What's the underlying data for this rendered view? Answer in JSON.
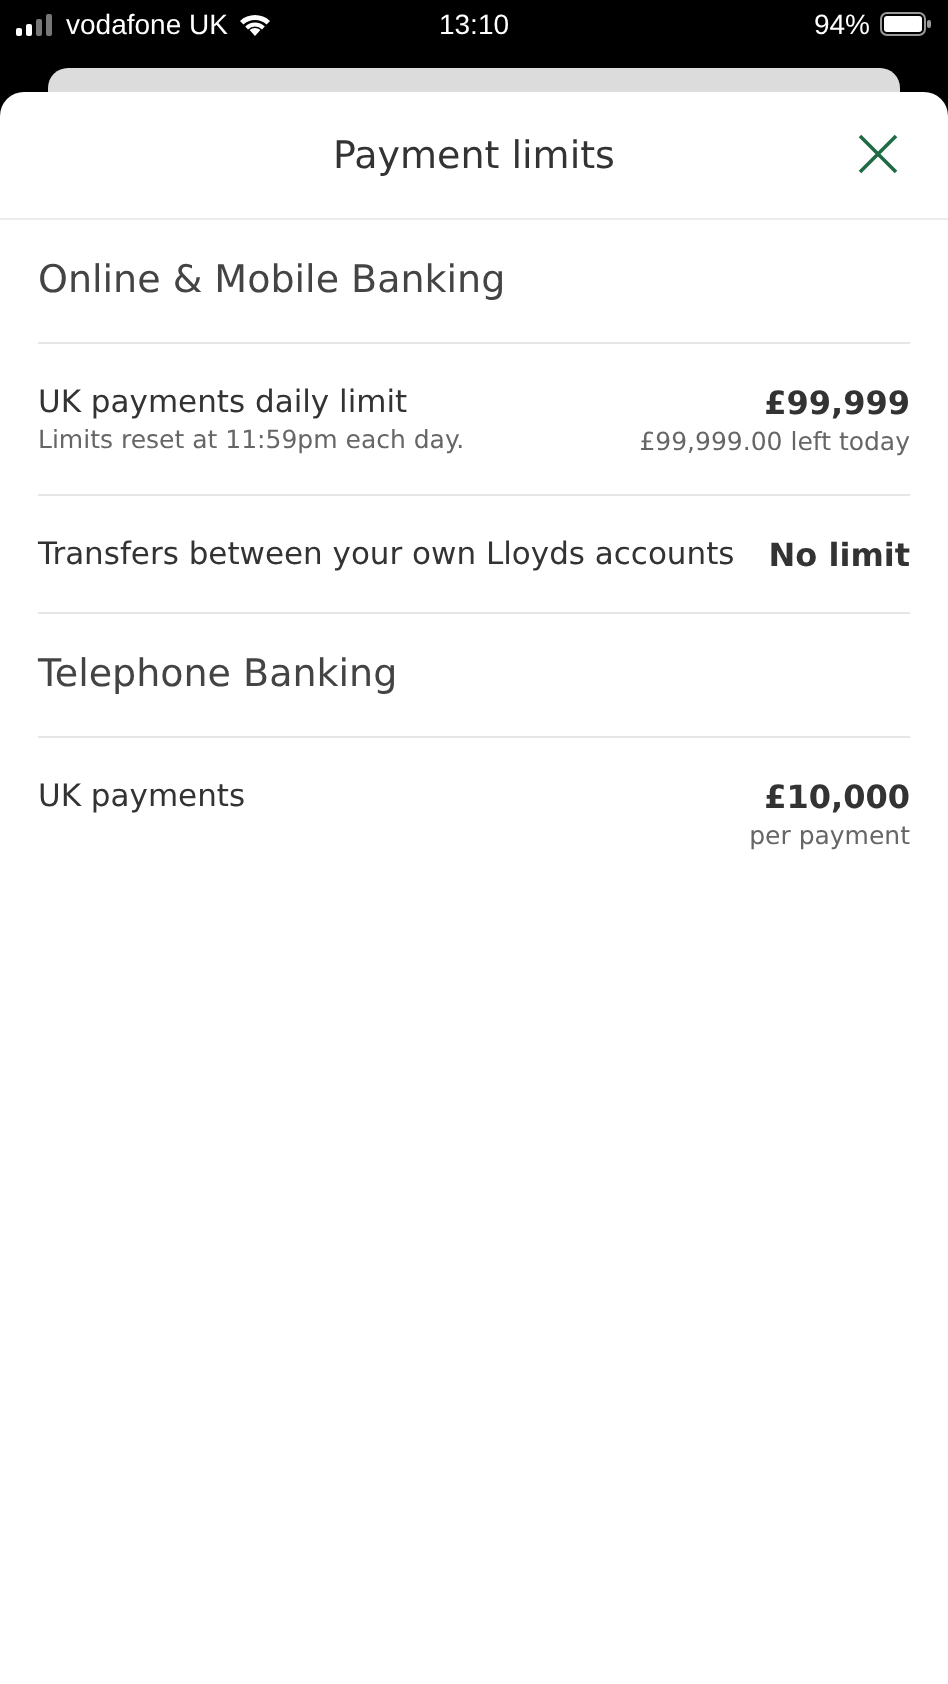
{
  "status_bar": {
    "carrier": "vodafone UK",
    "time": "13:10",
    "battery": "94%"
  },
  "header": {
    "title": "Payment limits"
  },
  "sections": [
    {
      "title": "Online & Mobile Banking",
      "rows": [
        {
          "label": "UK payments daily limit",
          "note": "Limits reset at 11:59pm each day.",
          "value": "£99,999",
          "value_note": "£99,999.00 left today"
        },
        {
          "label": "Transfers between your own Lloyds accounts",
          "value": "No limit"
        }
      ]
    },
    {
      "title": "Telephone Banking",
      "rows": [
        {
          "label": "UK payments",
          "value": "£10,000",
          "value_note": "per payment"
        }
      ]
    }
  ]
}
